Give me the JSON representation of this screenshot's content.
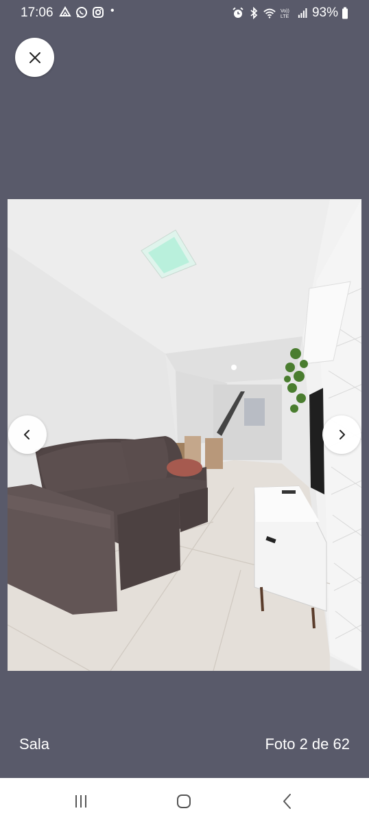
{
  "status_bar": {
    "time": "17:06",
    "left_icons": [
      "drive-icon",
      "whatsapp-icon",
      "instagram-icon"
    ],
    "dot": "•",
    "right_icons": [
      "alarm-icon",
      "bluetooth-icon",
      "wifi-icon",
      "volte-icon",
      "signal-icon"
    ],
    "volte_text": "Vo)) LTE",
    "battery_percent": "93%",
    "battery_level": 0.93
  },
  "viewer": {
    "close_icon": "close-icon",
    "prev_icon": "chevron-left-icon",
    "next_icon": "chevron-right-icon",
    "photo_subject": "Living room with grey sofa, white TV stand and tiled floor"
  },
  "caption": {
    "title": "Sala",
    "counter": "Foto 2 de 62"
  },
  "navigation_bar": {
    "recents_icon": "recents-icon",
    "home_icon": "home-icon",
    "back_icon": "back-icon"
  },
  "colors": {
    "background": "#595a6a",
    "white": "#ffffff"
  }
}
